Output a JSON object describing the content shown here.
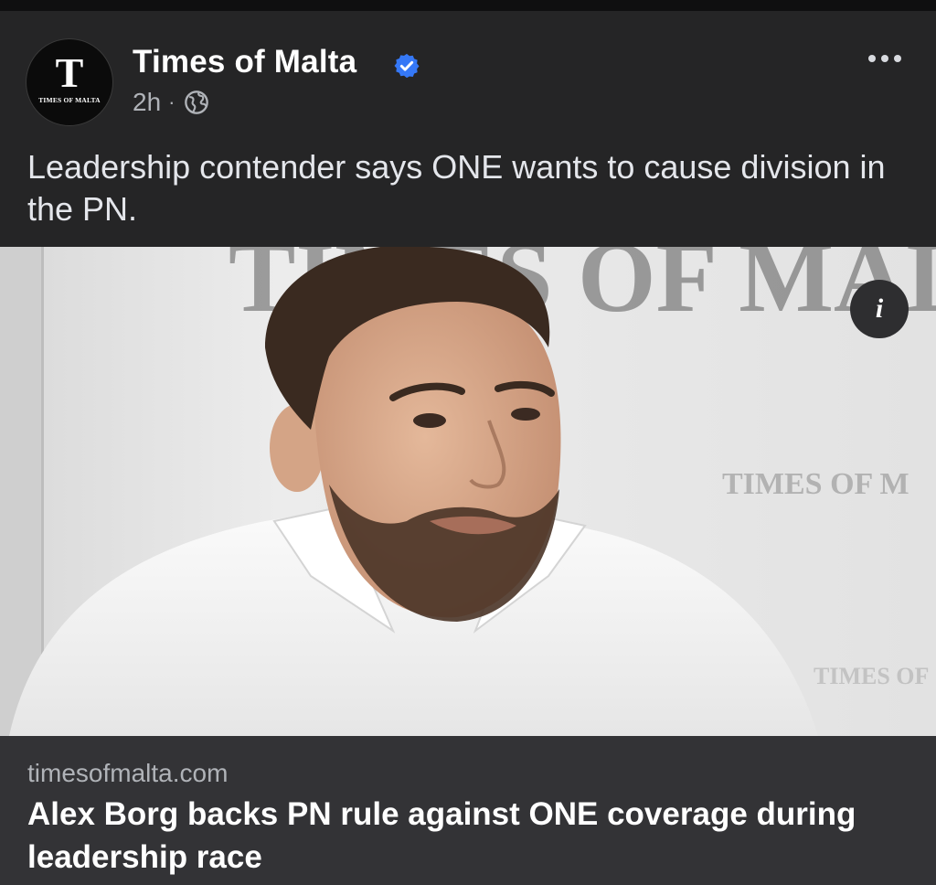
{
  "post": {
    "page_name": "Times of Malta",
    "avatar": {
      "letter": "T",
      "wordmark": "TIMES OF MALTA"
    },
    "time": "2h",
    "separator": "·",
    "audience_icon": "globe-icon",
    "verified_icon": "verified-badge-icon",
    "more_icon": "more-options-icon",
    "caption": "Leadership contender says ONE wants to cause division in the PN."
  },
  "image": {
    "info_label": "i",
    "backdrop_text": "TIMES OF MALTA",
    "subject": "Man with beard in white shirt"
  },
  "link_preview": {
    "domain": "timesofmalta.com",
    "headline": "Alex Borg backs PN rule against ONE coverage during leadership race"
  },
  "colors": {
    "background": "#252526",
    "link_box": "#333336",
    "verified": "#3578f6",
    "secondary_text": "#b0b3b8"
  }
}
